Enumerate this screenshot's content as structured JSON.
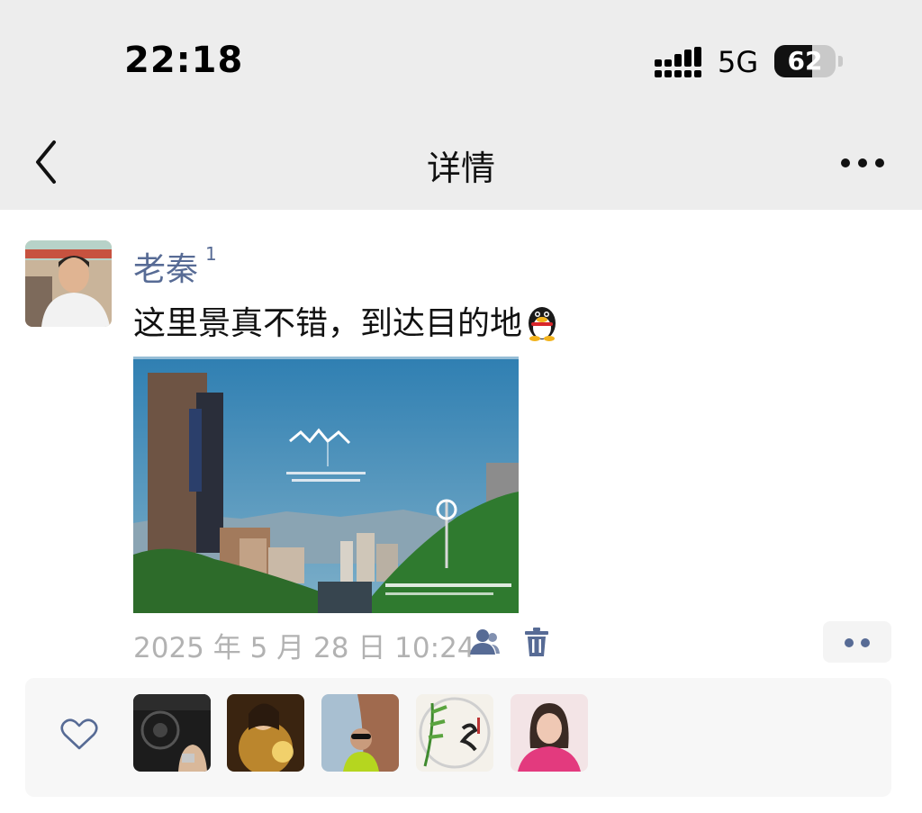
{
  "status_bar": {
    "time": "22:18",
    "network": "5G",
    "battery": "62",
    "battery_level": 0.62
  },
  "nav": {
    "title": "详情",
    "back_icon": "chevron-left-icon",
    "more_icon": "more-dots-icon"
  },
  "post": {
    "author": "老秦",
    "author_badge": "1",
    "text": "这里景真不错，到达目的地",
    "emoji": "qq-penguin-emoji",
    "timestamp": "2025 年 5 月 28 日 10:24",
    "icons": [
      "friends-visibility-icon",
      "trash-icon",
      "comment-action-icon"
    ]
  },
  "likes": {
    "icon": "heart-icon",
    "users": [
      "liker-1",
      "liker-2",
      "liker-3",
      "liker-4",
      "liker-5"
    ]
  },
  "colors": {
    "nav_bg": "#ededed",
    "name_color": "#576b95",
    "timestamp_color": "#b2b2b2",
    "likes_bg": "#f7f7f7"
  }
}
